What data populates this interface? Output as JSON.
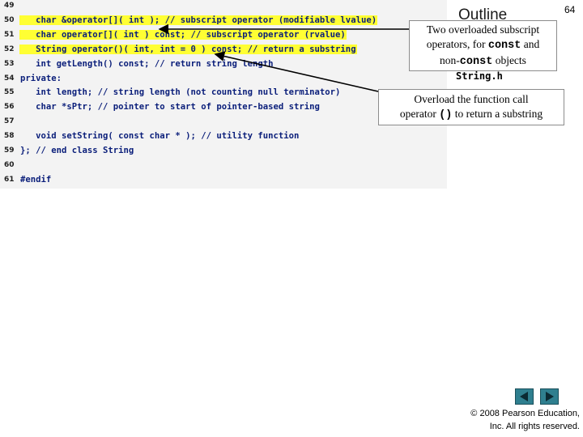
{
  "code": [
    {
      "num": "49",
      "text": ""
    },
    {
      "num": "50",
      "text": "   char &operator[]( int ); // subscript operator (modifiable lvalue)"
    },
    {
      "num": "51",
      "text": "   char operator[]( int ) const; // subscript operator (rvalue)"
    },
    {
      "num": "52",
      "text": "   String operator()( int, int = 0 ) const; // return a substring"
    },
    {
      "num": "53",
      "text": "   int getLength() const; // return string length"
    },
    {
      "num": "54",
      "text": "private:"
    },
    {
      "num": "55",
      "text": "   int length; // string length (not counting null terminator)"
    },
    {
      "num": "56",
      "text": "   char *sPtr; // pointer to start of pointer-based string"
    },
    {
      "num": "57",
      "text": ""
    },
    {
      "num": "58",
      "text": "   void setString( const char * ); // utility function"
    },
    {
      "num": "59",
      "text": "}; // end class String"
    },
    {
      "num": "60",
      "text": ""
    },
    {
      "num": "61",
      "text": "#endif"
    }
  ],
  "page_number": "64",
  "outline_title": "Outline",
  "file_name": "String.h",
  "callout1": {
    "line1": "Two overloaded subscript",
    "line2_pre": "operators, for ",
    "line2_code": "const",
    "line2_post": " and",
    "line3_pre": "non-",
    "line3_code": "const",
    "line3_post": " objects"
  },
  "callout2": {
    "line1": "Overload the function call",
    "line2_pre": "operator ",
    "line2_code": "()",
    "line2_post": " to return a substring"
  },
  "nav": {
    "prev_icon": "triangle-left-icon",
    "next_icon": "triangle-right-icon"
  },
  "copyright": {
    "line1": "© 2008 Pearson Education,",
    "line2": "Inc. All rights reserved."
  },
  "colors": {
    "highlight": "#ffff33",
    "code_text": "#0a1e7a",
    "panel_bg": "#f3f3f3",
    "nav_button": "#2f7f8f"
  }
}
